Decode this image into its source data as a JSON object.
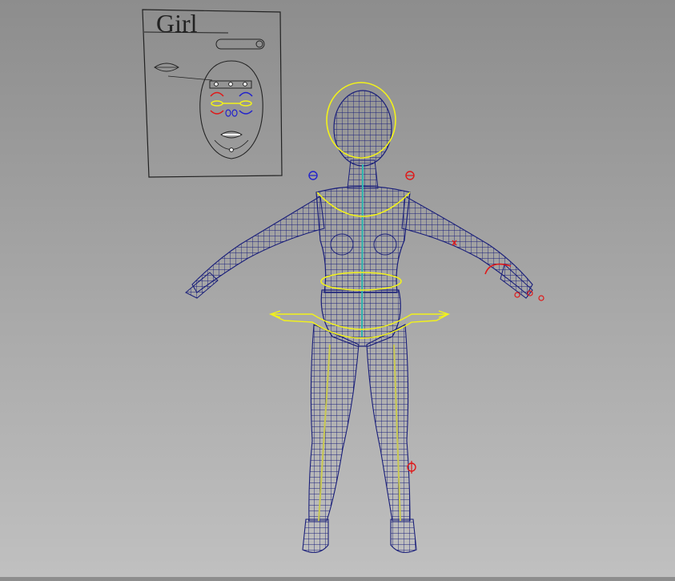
{
  "panel": {
    "title": "Girl"
  },
  "colors": {
    "background_top": "#8d8d8d",
    "background_bottom": "#c0c0c0",
    "wireframe": "#1a1f7a",
    "control_yellow": "#f2f21a",
    "control_red": "#e01818",
    "control_blue": "#2222cc",
    "panel_line": "#222222"
  }
}
